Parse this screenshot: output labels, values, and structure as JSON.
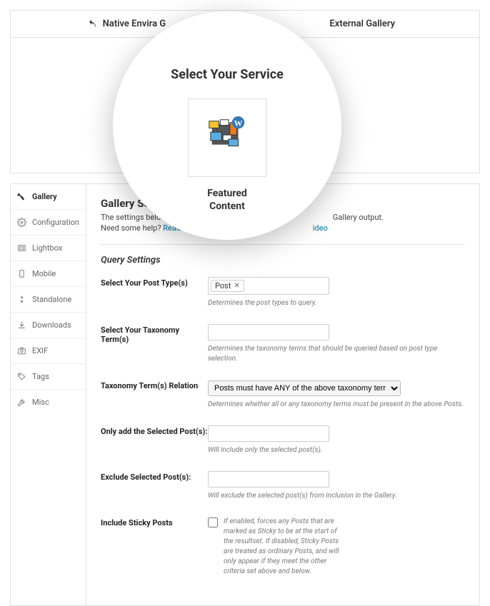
{
  "tabs": {
    "native": "Native Envira G",
    "external": "External Gallery"
  },
  "magnifier": {
    "title": "Select Your Service",
    "featured_line1": "Featured",
    "featured_line2": "Content"
  },
  "sidebar": {
    "items": [
      {
        "label": "Gallery"
      },
      {
        "label": "Configuration"
      },
      {
        "label": "Lightbox"
      },
      {
        "label": "Mobile"
      },
      {
        "label": "Standalone"
      },
      {
        "label": "Downloads"
      },
      {
        "label": "EXIF"
      },
      {
        "label": "Tags"
      },
      {
        "label": "Misc"
      }
    ]
  },
  "settings": {
    "heading": "Gallery Setti",
    "desc_prefix": "The settings below a",
    "desc_suffix": " Gallery output.",
    "help_prefix": "Need some help? ",
    "help_link_start": "Read the ",
    "help_link_end": "ideo"
  },
  "query": {
    "heading": "Query Settings",
    "post_type": {
      "label": "Select Your Post Type(s)",
      "chip": "Post",
      "hint": "Determines the post types to query."
    },
    "taxonomy": {
      "label": "Select Your Taxonomy Term(s)",
      "hint": "Determines the taxonomy terms that should be queried based on post type selection."
    },
    "relation": {
      "label": "Taxonomy Term(s) Relation",
      "option": "Posts must have ANY of the above taxonomy terms (IN)",
      "hint": "Determines whether all or any taxonomy terms must be present in the above Posts."
    },
    "only": {
      "label": "Only add the Selected Post(s):",
      "hint": "Will include only the selected post(s)."
    },
    "exclude": {
      "label": "Exclude Selected Post(s):",
      "hint": "Will exclude the selected post(s) from inclusion in the Gallery."
    },
    "sticky": {
      "label": "Include Sticky Posts",
      "hint": "If enabled, forces any Posts that are marked as Sticky to be at the start of the resultset. If disabled, Sticky Posts are treated as ordinary Posts, and will only appear if they meet the other criteria set above and below."
    }
  }
}
